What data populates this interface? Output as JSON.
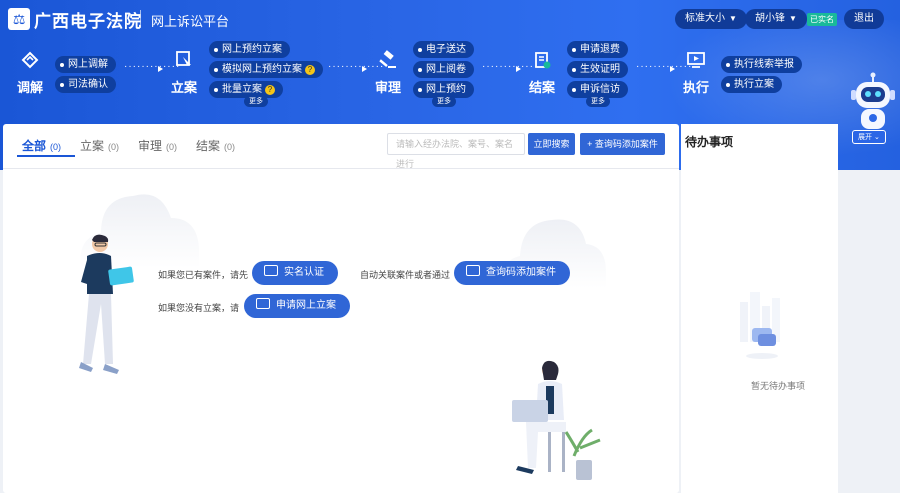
{
  "header": {
    "logo_glyph": "⚖",
    "brand": "广西电子法院",
    "platform": "网上诉讼平台",
    "font_size_label": "标准大小",
    "user_name": "胡小锋",
    "verified_badge": "已实名",
    "logout_label": "退出"
  },
  "flow": {
    "stages": [
      {
        "label": "调解",
        "icon": "handshake-icon"
      },
      {
        "label": "立案",
        "icon": "pointer-icon"
      },
      {
        "label": "审理",
        "icon": "gavel-icon"
      },
      {
        "label": "结案",
        "icon": "document-check-icon"
      },
      {
        "label": "执行",
        "icon": "monitor-icon"
      }
    ],
    "mediation_items": [
      "网上调解",
      "司法确认"
    ],
    "filing_items": [
      "网上预约立案",
      "模拟网上预约立案",
      "批量立案"
    ],
    "trial_items": [
      "电子送达",
      "网上阅卷",
      "网上预约"
    ],
    "closing_items": [
      "申请退费",
      "生效证明",
      "申诉信访"
    ],
    "execution_items": [
      "执行线索举报",
      "执行立案"
    ],
    "more_label": "更多",
    "help_glyph": "?"
  },
  "assistant": {
    "expand_label": "展开"
  },
  "main": {
    "tabs": [
      {
        "label": "全部",
        "count": "(0)"
      },
      {
        "label": "立案",
        "count": "(0)"
      },
      {
        "label": "审理",
        "count": "(0)"
      },
      {
        "label": "结案",
        "count": "(0)"
      }
    ],
    "search_placeholder": "请输入经办法院、案号、案名进行",
    "search_button": "立即搜索",
    "add_case_button": "+ 查询码添加案件",
    "prompt_have_case": "如果您已有案件，请先",
    "realname_button": "实名认证",
    "prompt_link_case": "自动关联案件或者通过",
    "query_code_button": "查询码添加案件",
    "prompt_no_case": "如果您没有立案，请",
    "apply_filing_button": "申请网上立案"
  },
  "side": {
    "title": "待办事项",
    "empty_text": "暂无待办事项"
  }
}
